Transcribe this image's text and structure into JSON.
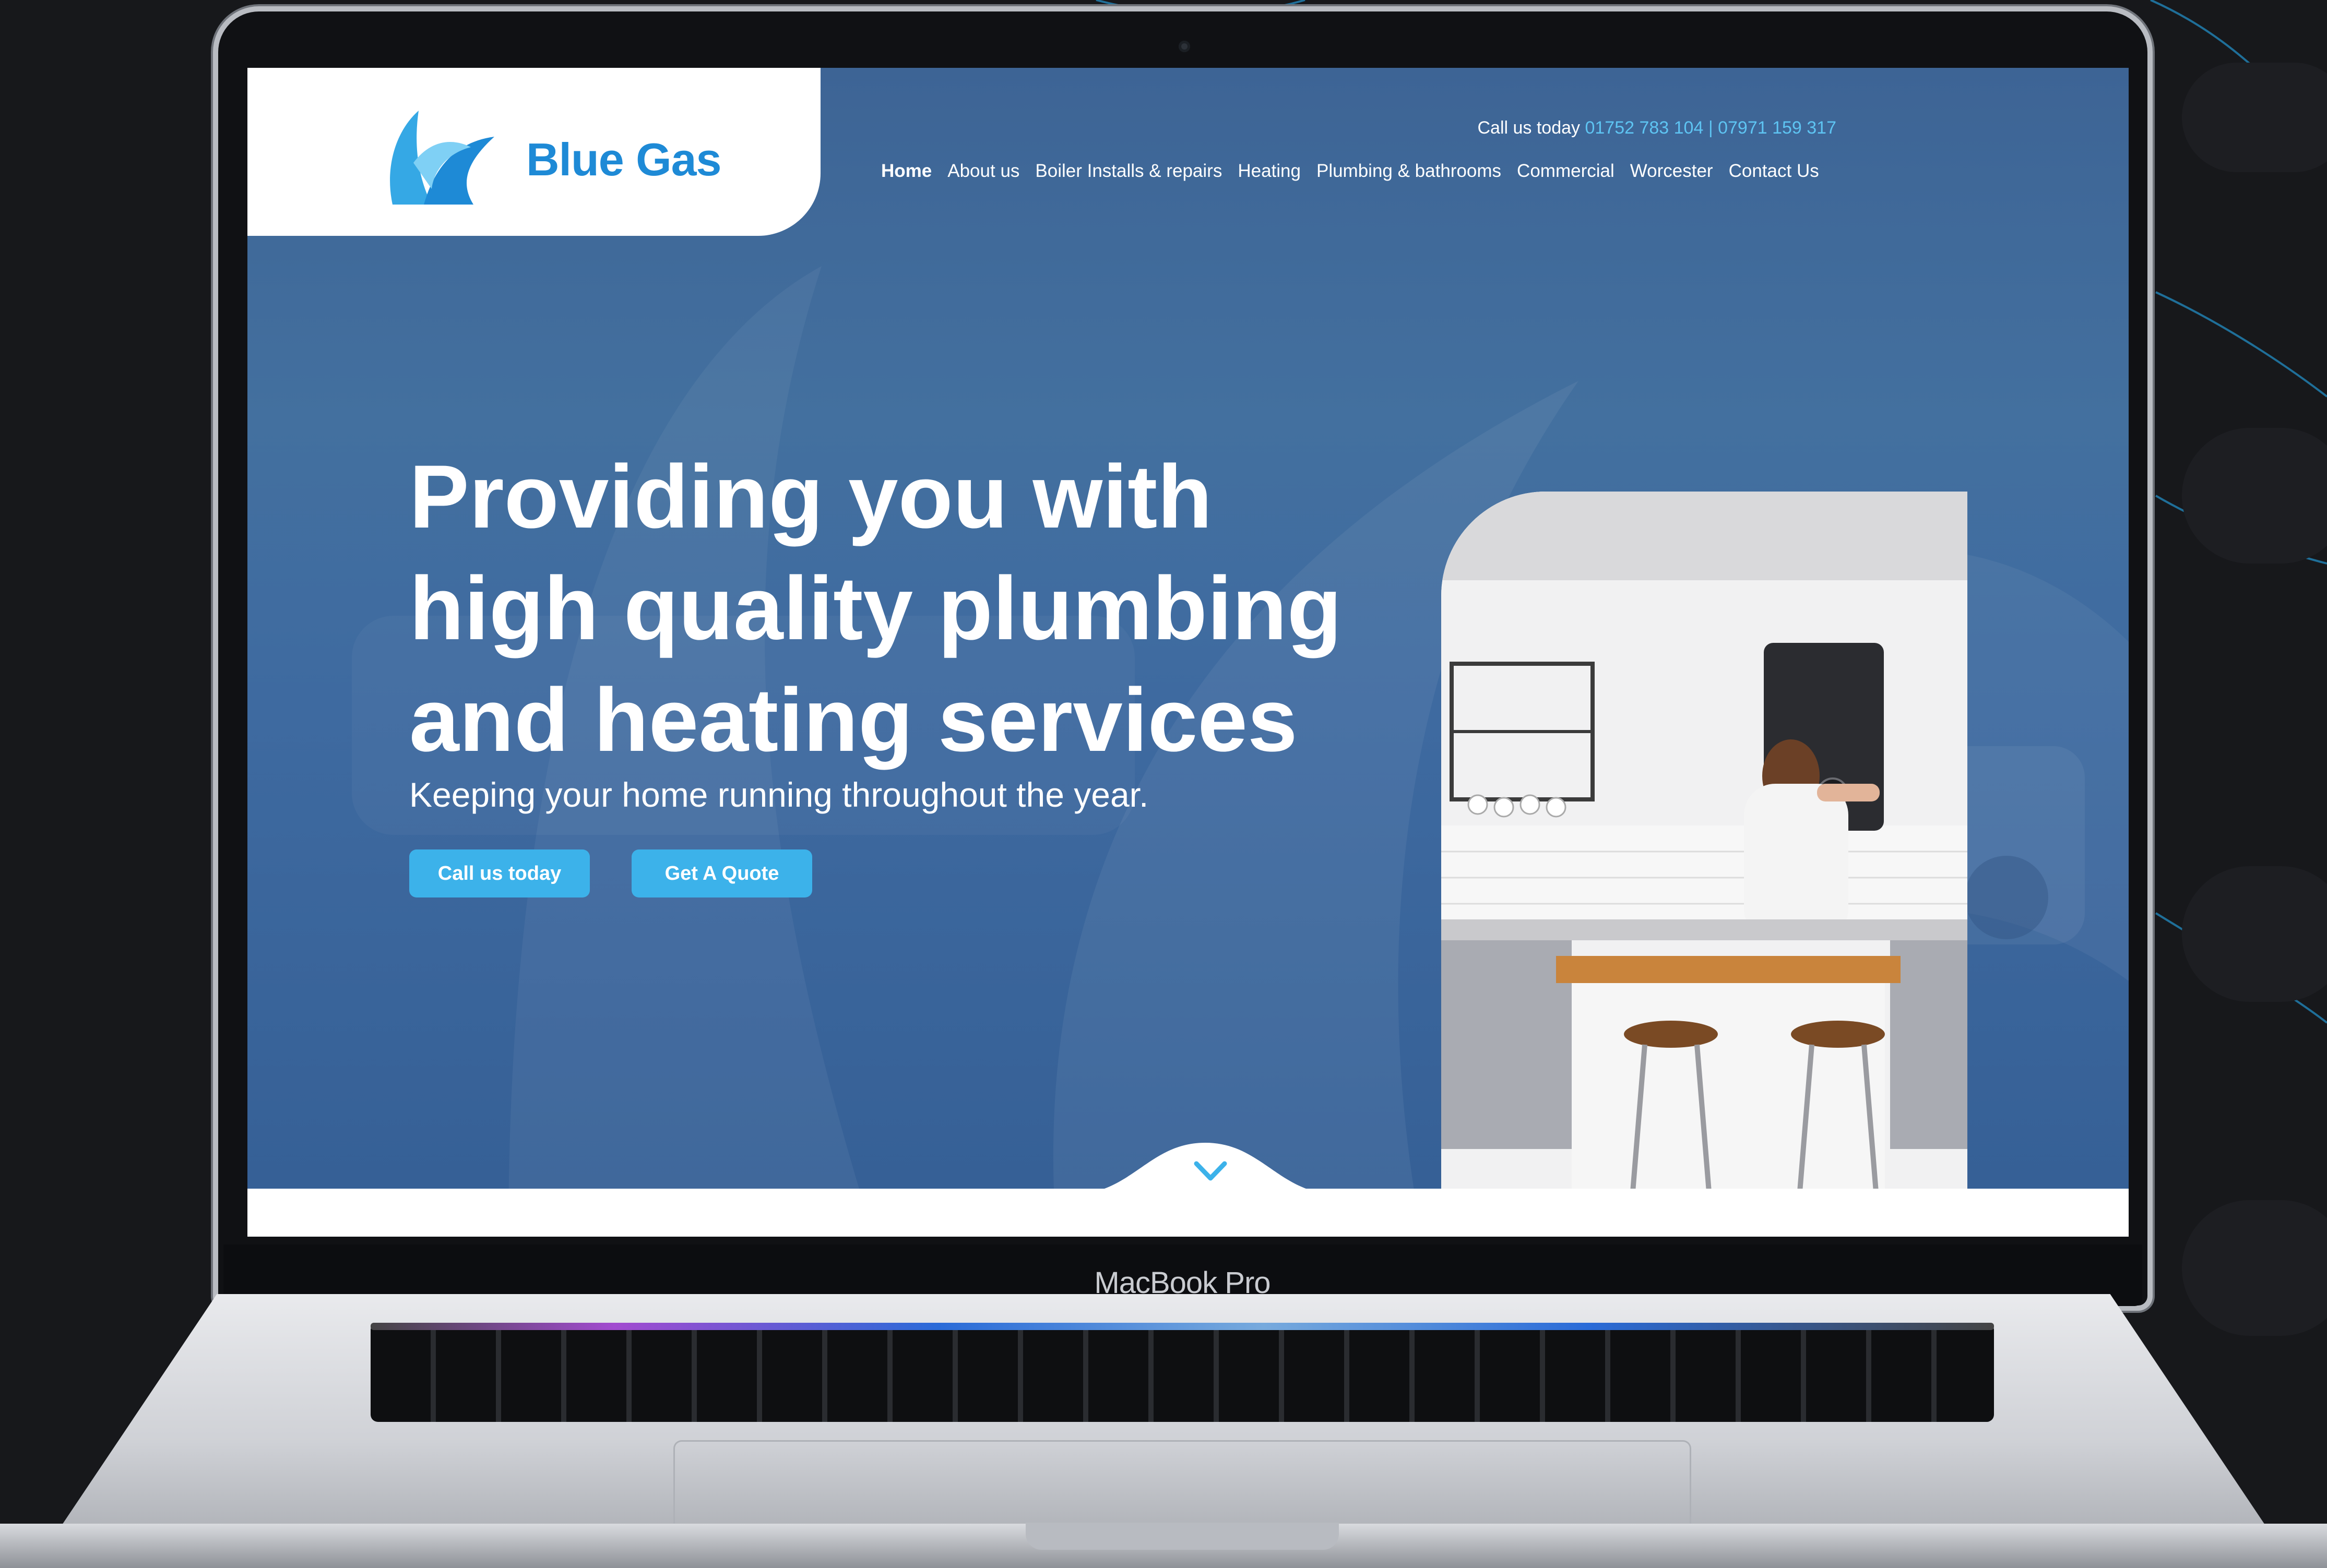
{
  "device": {
    "label": "MacBook Pro"
  },
  "site": {
    "brand": "Blue Gas",
    "call": {
      "prefix": "Call us today",
      "numbers": "01752 783 104 | 07971 159 317"
    },
    "nav": [
      {
        "label": "Home",
        "active": true
      },
      {
        "label": "About us",
        "active": false
      },
      {
        "label": "Boiler Installs & repairs",
        "active": false
      },
      {
        "label": "Heating",
        "active": false
      },
      {
        "label": "Plumbing & bathrooms",
        "active": false
      },
      {
        "label": "Commercial",
        "active": false
      },
      {
        "label": "Worcester",
        "active": false
      },
      {
        "label": "Contact Us",
        "active": false
      }
    ],
    "hero": {
      "headline_lines": [
        "Providing you with",
        "high quality plumbing",
        "and heating services"
      ],
      "subheading": "Keeping your home running throughout the year.",
      "buttons": {
        "call": "Call us today",
        "quote": "Get A Quote"
      }
    }
  },
  "colors": {
    "hero_blue": "#3e6aa0",
    "accent": "#3cb2ea",
    "logo_blue": "#1e8ad6",
    "phone_text": "#5ec4f2",
    "backdrop": "#17181b"
  },
  "icons": {
    "logo": "blue-gas-flame-logo",
    "scroll": "chevron-down-icon",
    "webcam": "camera-icon"
  }
}
